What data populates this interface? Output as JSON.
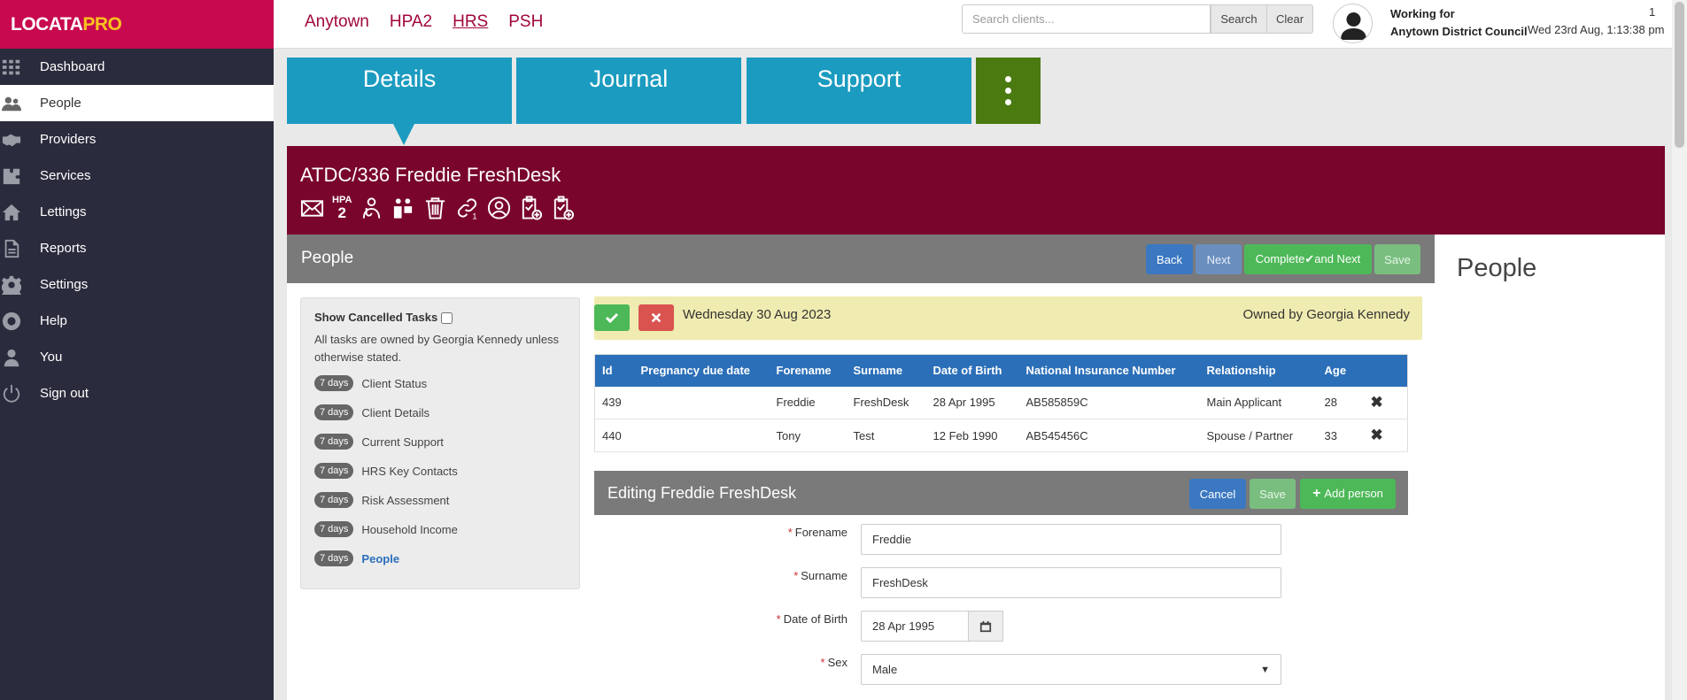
{
  "app": {
    "logo_part1": "LOCATA",
    "logo_part2": "PRO"
  },
  "sidebar": {
    "items": [
      {
        "label": "Dashboard",
        "icon": "grid-icon"
      },
      {
        "label": "People",
        "icon": "people-icon",
        "active": true
      },
      {
        "label": "Providers",
        "icon": "handshake-icon"
      },
      {
        "label": "Services",
        "icon": "puzzle-icon"
      },
      {
        "label": "Lettings",
        "icon": "home-icon"
      },
      {
        "label": "Reports",
        "icon": "report-icon"
      },
      {
        "label": "Settings",
        "icon": "gear-icon"
      },
      {
        "label": "Help",
        "icon": "lifebuoy-icon"
      },
      {
        "label": "You",
        "icon": "user-icon"
      },
      {
        "label": "Sign out",
        "icon": "power-icon"
      }
    ]
  },
  "topbar": {
    "orgs": [
      "Anytown",
      "HPA2",
      "HRS",
      "PSH"
    ],
    "current_org": "HRS",
    "search_placeholder": "Search clients...",
    "search_label": "Search",
    "clear_label": "Clear",
    "working_for": "Working for",
    "council": "Anytown District Council",
    "count": "1",
    "datetime": "Wed 23rd Aug, 1:13:38 pm"
  },
  "tabs": [
    {
      "label": "Details",
      "active": true
    },
    {
      "label": "Journal"
    },
    {
      "label": "Support"
    }
  ],
  "client": {
    "title": "ATDC/336 Freddie FreshDesk",
    "hpa_top": "HPA",
    "hpa_bottom": "2",
    "link_sub": "1"
  },
  "panel": {
    "title": "People",
    "back": "Back",
    "next": "Next",
    "complete_pre": "Complete",
    "complete_post": "and Next",
    "save": "Save"
  },
  "right_panel": {
    "title": "People"
  },
  "tasks": {
    "show_cancelled": "Show Cancelled Tasks",
    "note": "All tasks are owned by Georgia Kennedy unless otherwise stated.",
    "items": [
      {
        "badge": "7 days",
        "label": "Client Status"
      },
      {
        "badge": "7 days",
        "label": "Client Details"
      },
      {
        "badge": "7 days",
        "label": "Current Support"
      },
      {
        "badge": "7 days",
        "label": "HRS Key Contacts"
      },
      {
        "badge": "7 days",
        "label": "Risk Assessment"
      },
      {
        "badge": "7 days",
        "label": "Household Income"
      },
      {
        "badge": "7 days",
        "label": "People",
        "active": true
      }
    ]
  },
  "notice": {
    "date": "Wednesday 30 Aug 2023",
    "owner": "Owned by Georgia Kennedy"
  },
  "people_table": {
    "headers": [
      "Id",
      "Pregnancy due date",
      "Forename",
      "Surname",
      "Date of Birth",
      "National Insurance Number",
      "Relationship",
      "Age"
    ],
    "rows": [
      [
        "439",
        "",
        "Freddie",
        "FreshDesk",
        "28 Apr 1995",
        "AB585859C",
        "Main Applicant",
        "28"
      ],
      [
        "440",
        "",
        "Tony",
        "Test",
        "12 Feb 1990",
        "AB545456C",
        "Spouse / Partner",
        "33"
      ]
    ]
  },
  "editing": {
    "title": "Editing Freddie FreshDesk",
    "cancel": "Cancel",
    "save": "Save",
    "add_person": "Add person",
    "required_mark": "*",
    "fields": [
      {
        "label": "Forename",
        "value": "Freddie"
      },
      {
        "label": "Surname",
        "value": "FreshDesk"
      },
      {
        "label": "Date of Birth",
        "value": "28 Apr 1995"
      },
      {
        "label": "Sex",
        "value": "Male"
      }
    ]
  },
  "colors": {
    "brand": "#c8094f",
    "client_bar": "#79052c",
    "tab": "#1b9bc0",
    "sidebar": "#2a2c3d"
  }
}
